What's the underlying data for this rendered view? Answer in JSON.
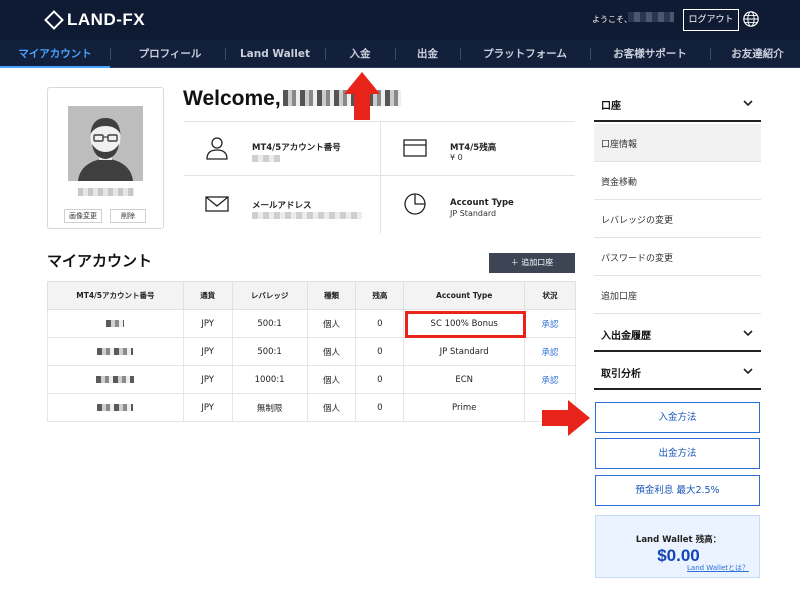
{
  "header": {
    "logo": "LAND-FX",
    "greeting": "ようこそ、",
    "logout_label": "ログアウト",
    "globe_icon": "globe-icon"
  },
  "nav": {
    "items": [
      {
        "label": "マイアカウント"
      },
      {
        "label": "プロフィール"
      },
      {
        "label": "Land Wallet"
      },
      {
        "label": "入金"
      },
      {
        "label": "出金"
      },
      {
        "label": "プラットフォーム"
      },
      {
        "label": "お客様サポート"
      },
      {
        "label": "お友達紹介"
      }
    ],
    "active_color": "#4aa3ff"
  },
  "profile": {
    "change_image_label": "画像変更",
    "delete_label": "削除"
  },
  "welcome": {
    "text": "Welcome,"
  },
  "info": {
    "account_number_label": "MT4/5アカウント番号",
    "balance_label": "MT4/5残高",
    "balance_value": "¥ 0",
    "email_label": "メールアドレス",
    "account_type_label": "Account Type",
    "account_type_value": "JP Standard"
  },
  "my_accounts": {
    "title": "マイアカウント",
    "add_button": "＋ 追加口座",
    "columns": [
      "MT4/5アカウント番号",
      "通貨",
      "レバレッジ",
      "種類",
      "残高",
      "Account Type",
      "状況"
    ],
    "rows": [
      {
        "currency": "JPY",
        "leverage": "500:1",
        "kind": "個人",
        "balance": "0",
        "type": "SC 100% Bonus",
        "status": "承認"
      },
      {
        "currency": "JPY",
        "leverage": "500:1",
        "kind": "個人",
        "balance": "0",
        "type": "JP Standard",
        "status": "承認"
      },
      {
        "currency": "JPY",
        "leverage": "1000:1",
        "kind": "個人",
        "balance": "0",
        "type": "ECN",
        "status": "承認"
      },
      {
        "currency": "JPY",
        "leverage": "無制限",
        "kind": "個人",
        "balance": "0",
        "type": "Prime",
        "status": ""
      }
    ],
    "highlight_color": "#e8231a"
  },
  "sidebar": {
    "account_header": "口座",
    "account_items": [
      {
        "label": "口座情報"
      },
      {
        "label": "資金移動"
      },
      {
        "label": "レバレッジの変更"
      },
      {
        "label": "パスワードの変更"
      },
      {
        "label": "追加口座"
      }
    ],
    "history_header": "入出金履歴",
    "analysis_header": "取引分析",
    "deposit_method": "入金方法",
    "withdraw_method": "出金方法",
    "interest_label": "預金利息 最大2.5%",
    "wallet_title": "Land Wallet 残高：",
    "wallet_amount": "$0.00",
    "wallet_link": "Land Walletとは？"
  }
}
